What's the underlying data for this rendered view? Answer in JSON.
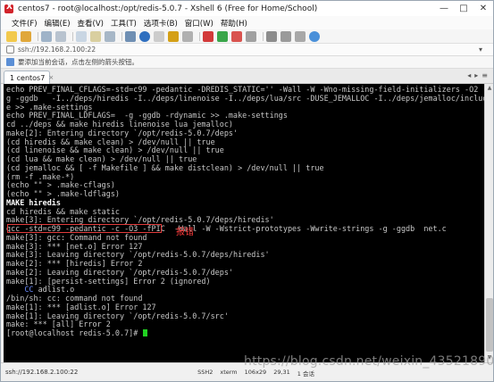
{
  "window": {
    "title": "centos7 - root@localhost:/opt/redis-5.0.7 - Xshell 6 (Free for Home/School)",
    "controls": [
      "—",
      "□",
      "✕"
    ]
  },
  "menu": [
    "文件(F)",
    "编辑(E)",
    "查看(V)",
    "工具(T)",
    "选项卡(B)",
    "窗口(W)",
    "帮助(H)"
  ],
  "address": {
    "text": "ssh://192.168.2.100:22",
    "arrow": "▾"
  },
  "hint": {
    "text": "要添加当前会话，点击左侧的箭头按钮。"
  },
  "tabs": [
    {
      "label": "1 centos7",
      "close": "×",
      "active": true
    }
  ],
  "tab_nav": [
    "◂",
    "▸",
    "≡"
  ],
  "terminal": {
    "lines": [
      {
        "text": "echo PREV_FINAL_CFLAGS=-std=c99 -pedantic -DREDIS_STATIC='' -Wall -W -Wno-missing-field-initializers -O2 -"
      },
      {
        "text": "g -ggdb   -I../deps/hiredis -I../deps/linenoise -I../deps/lua/src -DUSE_JEMALLOC -I../deps/jemalloc/include"
      },
      {
        "text": "e >> .make-settings"
      },
      {
        "text": "echo PREV_FINAL_LDFLAGS=  -g -ggdb -rdynamic >> .make-settings"
      },
      {
        "text": "cd ../deps && make hiredis linenoise lua jemalloc)"
      },
      {
        "text": "make[2]: Entering directory `/opt/redis-5.0.7/deps'"
      },
      {
        "text": "(cd hiredis && make clean) > /dev/null || true"
      },
      {
        "text": "(cd linenoise && make clean) > /dev/null || true"
      },
      {
        "text": "(cd lua && make clean) > /dev/null || true"
      },
      {
        "text": "(cd jemalloc && [ -f Makefile ] && make distclean) > /dev/null || true"
      },
      {
        "text": "(rm -f .make-*)"
      },
      {
        "text": "(echo \"\" > .make-cflags)"
      },
      {
        "text": "(echo \"\" > .make-ldflags)"
      },
      {
        "text": "MAKE hiredis",
        "bold": true
      },
      {
        "text": "cd hiredis && make static"
      },
      {
        "text": "make[3]: Entering directory `/opt/redis-5.0.7/deps/hiredis'"
      },
      {
        "text": "gcc -std=c99 -pedantic -c -O3 -fPIC  -Wall -W -Wstrict-prototypes -Wwrite-strings -g -ggdb  net.c"
      },
      {
        "text": "make[3]: gcc: Command not found"
      },
      {
        "text": "make[3]: *** [net.o] Error 127"
      },
      {
        "text": "make[3]: Leaving directory `/opt/redis-5.0.7/deps/hiredis'"
      },
      {
        "text": "make[2]: *** [hiredis] Error 2"
      },
      {
        "text": "make[2]: Leaving directory `/opt/redis-5.0.7/deps'"
      },
      {
        "text": "make[1]: [persist-settings] Error 2 (ignored)"
      },
      {
        "text": "    CC adlist.o",
        "cc": true
      },
      {
        "text": "/bin/sh: cc: command not found"
      },
      {
        "text": "make[1]: *** [adlist.o] Error 127"
      },
      {
        "text": "make[1]: Leaving directory `/opt/redis-5.0.7/src'"
      },
      {
        "text": "make: *** [all] Error 2"
      },
      {
        "text": "[root@localhost redis-5.0.7]# "
      }
    ],
    "annotation": "报错",
    "colors": {
      "background": "#000000",
      "foreground": "#c7c7c7",
      "cursor": "#21d121",
      "annotation": "#ff3b3b"
    }
  },
  "status": {
    "left": "ssh://192.168.2.100:22",
    "items": [
      "SSH2",
      "xterm",
      "106x29",
      "29,31",
      "1 会话"
    ]
  },
  "watermark": "https://blog.csdn.net/weixin_43521890"
}
